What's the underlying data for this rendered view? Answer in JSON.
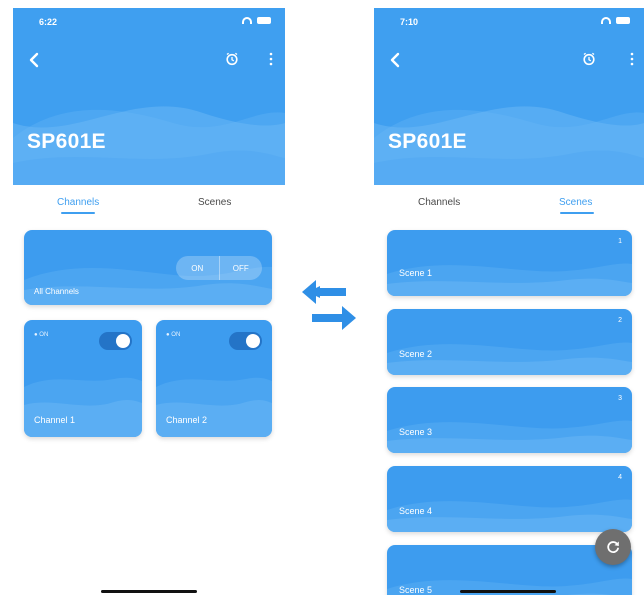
{
  "left_screen": {
    "status_time": "6:22",
    "device_name": "SP601E",
    "tabs": [
      "Channels",
      "Scenes"
    ],
    "active_tab": "Channels",
    "all_channels": {
      "label": "All Channels",
      "on_label": "ON",
      "off_label": "OFF"
    },
    "channels": [
      {
        "label": "Channel 1",
        "state": "● ON"
      },
      {
        "label": "Channel 2",
        "state": "● ON"
      }
    ]
  },
  "right_screen": {
    "status_time": "7:10",
    "device_name": "SP601E",
    "tabs": [
      "Channels",
      "Scenes"
    ],
    "active_tab": "Scenes",
    "scenes": [
      {
        "number": "1",
        "label": "Scene 1"
      },
      {
        "number": "2",
        "label": "Scene 2"
      },
      {
        "number": "3",
        "label": "Scene 3"
      },
      {
        "number": "4",
        "label": "Scene 4"
      },
      {
        "number": "5",
        "label": "Scene 5"
      }
    ]
  },
  "colors": {
    "primary": "#3f9ff0",
    "card": "#3d9cef",
    "toggle_track": "#2474c7",
    "fab": "#6f6f6f",
    "swap_arrows": "#2f8fe6"
  },
  "icons": [
    "back-icon",
    "alarm-clock-icon",
    "more-vertical-icon",
    "swap-arrows-icon",
    "refresh-icon"
  ]
}
